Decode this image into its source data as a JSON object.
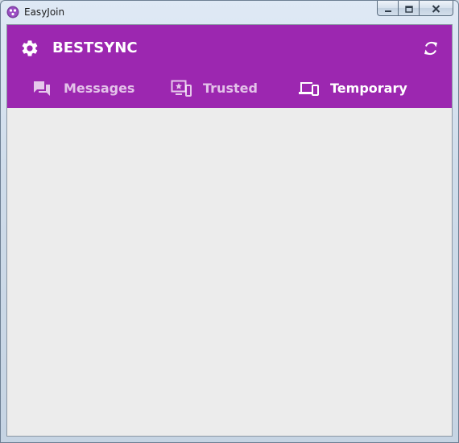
{
  "window": {
    "title": "EasyJoin"
  },
  "header": {
    "app_name": "BESTSYNC",
    "accent_color": "#9c27b0"
  },
  "tabs": [
    {
      "label": "Messages",
      "icon": "chat-icon",
      "active": false
    },
    {
      "label": "Trusted",
      "icon": "trusted-device-icon",
      "active": false
    },
    {
      "label": "Temporary",
      "icon": "devices-icon",
      "active": true
    }
  ],
  "icons": {
    "settings": "gear-icon",
    "refresh": "refresh-icon",
    "minimize": "minimize-icon",
    "maximize": "maximize-icon",
    "close": "close-icon"
  }
}
